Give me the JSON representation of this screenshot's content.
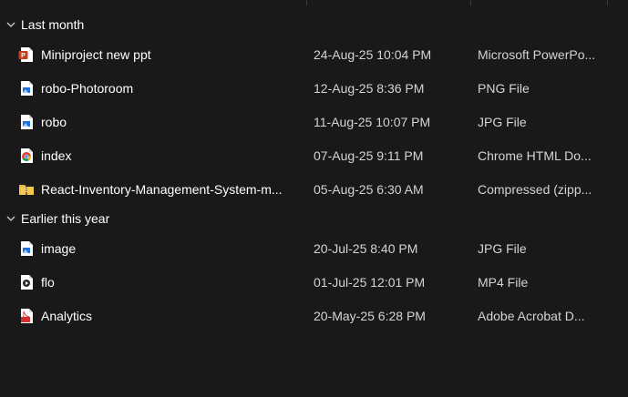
{
  "groups": [
    {
      "label": "Last month",
      "files": [
        {
          "name": "Miniproject new ppt",
          "date": "24-Aug-25 10:04 PM",
          "type": "Microsoft PowerPo...",
          "icon": "powerpoint-file-icon"
        },
        {
          "name": "robo-Photoroom",
          "date": "12-Aug-25 8:36 PM",
          "type": "PNG File",
          "icon": "image-file-icon"
        },
        {
          "name": "robo",
          "date": "11-Aug-25 10:07 PM",
          "type": "JPG File",
          "icon": "image-file-icon"
        },
        {
          "name": "index",
          "date": "07-Aug-25 9:11 PM",
          "type": "Chrome HTML Do...",
          "icon": "chrome-html-file-icon"
        },
        {
          "name": "React-Inventory-Management-System-m...",
          "date": "05-Aug-25 6:30 AM",
          "type": "Compressed (zipp...",
          "icon": "zip-folder-icon"
        }
      ]
    },
    {
      "label": "Earlier this year",
      "files": [
        {
          "name": "image",
          "date": "20-Jul-25 8:40 PM",
          "type": "JPG File",
          "icon": "image-file-icon"
        },
        {
          "name": "flo",
          "date": "01-Jul-25 12:01 PM",
          "type": "MP4 File",
          "icon": "video-file-icon"
        },
        {
          "name": "Analytics",
          "date": "20-May-25 6:28 PM",
          "type": "Adobe Acrobat D...",
          "icon": "pdf-file-icon"
        }
      ]
    }
  ],
  "colors": {
    "background": "#191919",
    "text": "#ffffff",
    "secondary_text": "#d4d4d4",
    "powerpoint": "#c43e1c",
    "pdf": "#d32f2f",
    "image_blue": "#1e6fd9",
    "zip_yellow": "#e8b640"
  }
}
